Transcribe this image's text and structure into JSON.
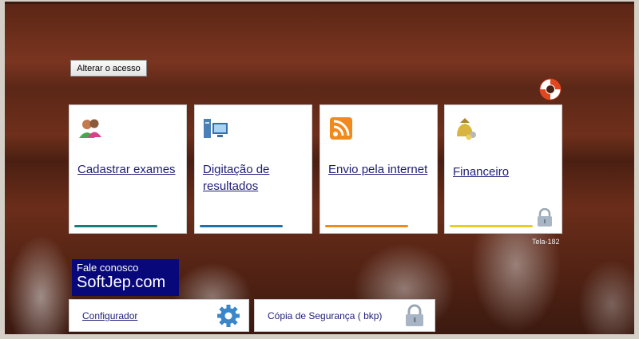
{
  "window": {
    "screen_id": "Tela-182"
  },
  "header": {
    "access_button_label": "Alterar o acesso"
  },
  "tiles": [
    {
      "label": "Cadastrar exames",
      "icon": "users-icon",
      "accent": "#1a7c78"
    },
    {
      "label": "Digitação de resultados",
      "icon": "computer-icon",
      "accent": "#1f6fa8"
    },
    {
      "label": "Envio pela internet",
      "icon": "rss-icon",
      "accent": "#f08a1c"
    },
    {
      "label": "Financeiro",
      "icon": "money-bag-icon",
      "accent": "#e8cc2a",
      "locked": true
    }
  ],
  "contact": {
    "line1": "Fale conosco",
    "line2": "SoftJep.com"
  },
  "bottom_buttons": [
    {
      "label": "Configurador",
      "icon": "gear-icon"
    },
    {
      "label": "Cópia de Segurança ( bkp)",
      "icon": "lock-icon"
    }
  ],
  "colors": {
    "link": "#1e1e78",
    "contact_bg": "#08087a"
  }
}
